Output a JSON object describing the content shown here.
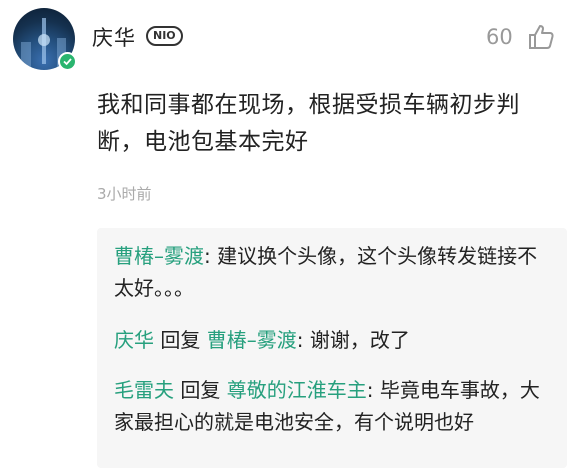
{
  "comment": {
    "author": "庆华",
    "badge": "NIO",
    "likes": "60",
    "text": "我和同事都在现场，根据受损车辆初步判断，电池包基本完好",
    "time": "3小时前"
  },
  "replies": [
    {
      "author": "曹椿–雾渡",
      "colon": ": ",
      "text": "建议换个头像，这个头像转发链接不太好。。。"
    },
    {
      "author": "庆华",
      "action": " 回复 ",
      "target": "曹椿–雾渡",
      "colon": ": ",
      "text": "谢谢，改了"
    },
    {
      "author": "毛雷夫",
      "action": " 回复 ",
      "target": "尊敬的江淮车主",
      "colon": ": ",
      "text": "毕竟电车事故，大家最担心的就是电池安全，有个说明也好"
    }
  ],
  "colors": {
    "name_green": "#27a07e",
    "verified_badge": "#2ab56f",
    "muted": "#999999"
  },
  "icons": {
    "like": "thumbs-up-icon",
    "verified": "check-icon"
  }
}
